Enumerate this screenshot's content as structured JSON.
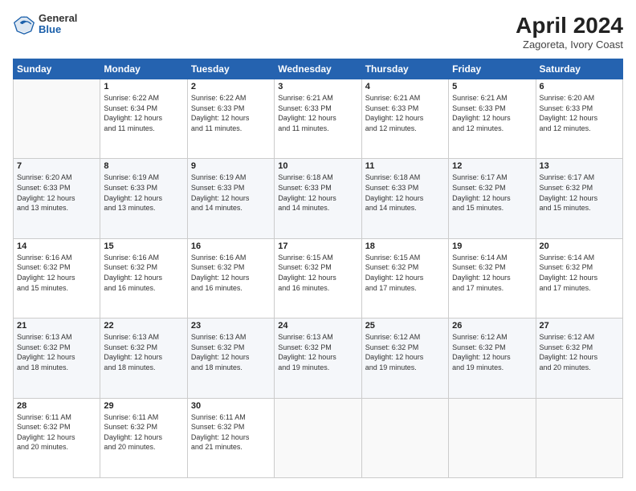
{
  "header": {
    "logo": {
      "line1": "General",
      "line2": "Blue"
    },
    "title": "April 2024",
    "subtitle": "Zagoreta, Ivory Coast"
  },
  "days_of_week": [
    "Sunday",
    "Monday",
    "Tuesday",
    "Wednesday",
    "Thursday",
    "Friday",
    "Saturday"
  ],
  "weeks": [
    [
      {
        "day": "",
        "info": ""
      },
      {
        "day": "1",
        "info": "Sunrise: 6:22 AM\nSunset: 6:34 PM\nDaylight: 12 hours\nand 11 minutes."
      },
      {
        "day": "2",
        "info": "Sunrise: 6:22 AM\nSunset: 6:33 PM\nDaylight: 12 hours\nand 11 minutes."
      },
      {
        "day": "3",
        "info": "Sunrise: 6:21 AM\nSunset: 6:33 PM\nDaylight: 12 hours\nand 11 minutes."
      },
      {
        "day": "4",
        "info": "Sunrise: 6:21 AM\nSunset: 6:33 PM\nDaylight: 12 hours\nand 12 minutes."
      },
      {
        "day": "5",
        "info": "Sunrise: 6:21 AM\nSunset: 6:33 PM\nDaylight: 12 hours\nand 12 minutes."
      },
      {
        "day": "6",
        "info": "Sunrise: 6:20 AM\nSunset: 6:33 PM\nDaylight: 12 hours\nand 12 minutes."
      }
    ],
    [
      {
        "day": "7",
        "info": ""
      },
      {
        "day": "8",
        "info": "Sunrise: 6:19 AM\nSunset: 6:33 PM\nDaylight: 12 hours\nand 13 minutes."
      },
      {
        "day": "9",
        "info": "Sunrise: 6:19 AM\nSunset: 6:33 PM\nDaylight: 12 hours\nand 14 minutes."
      },
      {
        "day": "10",
        "info": "Sunrise: 6:18 AM\nSunset: 6:33 PM\nDaylight: 12 hours\nand 14 minutes."
      },
      {
        "day": "11",
        "info": "Sunrise: 6:18 AM\nSunset: 6:33 PM\nDaylight: 12 hours\nand 14 minutes."
      },
      {
        "day": "12",
        "info": "Sunrise: 6:17 AM\nSunset: 6:32 PM\nDaylight: 12 hours\nand 15 minutes."
      },
      {
        "day": "13",
        "info": "Sunrise: 6:17 AM\nSunset: 6:32 PM\nDaylight: 12 hours\nand 15 minutes."
      }
    ],
    [
      {
        "day": "14",
        "info": ""
      },
      {
        "day": "15",
        "info": "Sunrise: 6:16 AM\nSunset: 6:32 PM\nDaylight: 12 hours\nand 16 minutes."
      },
      {
        "day": "16",
        "info": "Sunrise: 6:16 AM\nSunset: 6:32 PM\nDaylight: 12 hours\nand 16 minutes."
      },
      {
        "day": "17",
        "info": "Sunrise: 6:15 AM\nSunset: 6:32 PM\nDaylight: 12 hours\nand 16 minutes."
      },
      {
        "day": "18",
        "info": "Sunrise: 6:15 AM\nSunset: 6:32 PM\nDaylight: 12 hours\nand 17 minutes."
      },
      {
        "day": "19",
        "info": "Sunrise: 6:14 AM\nSunset: 6:32 PM\nDaylight: 12 hours\nand 17 minutes."
      },
      {
        "day": "20",
        "info": "Sunrise: 6:14 AM\nSunset: 6:32 PM\nDaylight: 12 hours\nand 17 minutes."
      }
    ],
    [
      {
        "day": "21",
        "info": ""
      },
      {
        "day": "22",
        "info": "Sunrise: 6:13 AM\nSunset: 6:32 PM\nDaylight: 12 hours\nand 18 minutes."
      },
      {
        "day": "23",
        "info": "Sunrise: 6:13 AM\nSunset: 6:32 PM\nDaylight: 12 hours\nand 18 minutes."
      },
      {
        "day": "24",
        "info": "Sunrise: 6:13 AM\nSunset: 6:32 PM\nDaylight: 12 hours\nand 19 minutes."
      },
      {
        "day": "25",
        "info": "Sunrise: 6:12 AM\nSunset: 6:32 PM\nDaylight: 12 hours\nand 19 minutes."
      },
      {
        "day": "26",
        "info": "Sunrise: 6:12 AM\nSunset: 6:32 PM\nDaylight: 12 hours\nand 19 minutes."
      },
      {
        "day": "27",
        "info": "Sunrise: 6:12 AM\nSunset: 6:32 PM\nDaylight: 12 hours\nand 20 minutes."
      }
    ],
    [
      {
        "day": "28",
        "info": "Sunrise: 6:11 AM\nSunset: 6:32 PM\nDaylight: 12 hours\nand 20 minutes."
      },
      {
        "day": "29",
        "info": "Sunrise: 6:11 AM\nSunset: 6:32 PM\nDaylight: 12 hours\nand 20 minutes."
      },
      {
        "day": "30",
        "info": "Sunrise: 6:11 AM\nSunset: 6:32 PM\nDaylight: 12 hours\nand 21 minutes."
      },
      {
        "day": "",
        "info": ""
      },
      {
        "day": "",
        "info": ""
      },
      {
        "day": "",
        "info": ""
      },
      {
        "day": "",
        "info": ""
      }
    ]
  ]
}
